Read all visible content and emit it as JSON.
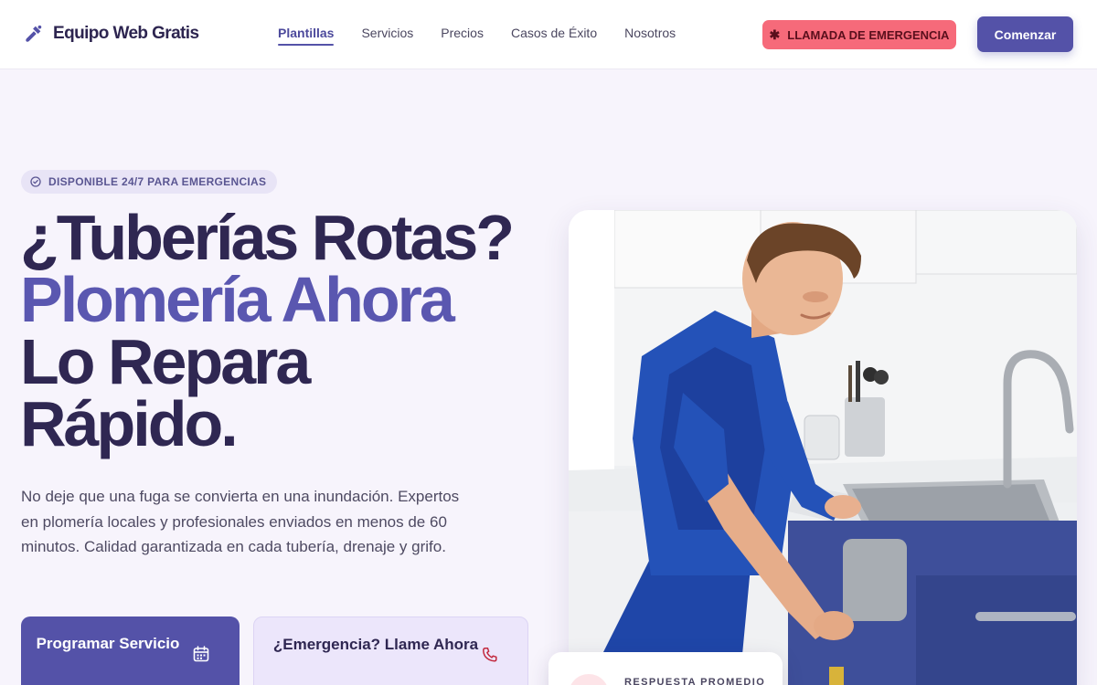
{
  "brand": {
    "name": "Equipo Web Gratis",
    "icon": "hammer-icon"
  },
  "nav": {
    "items": [
      {
        "label": "Plantillas",
        "active": true
      },
      {
        "label": "Servicios",
        "active": false
      },
      {
        "label": "Precios",
        "active": false
      },
      {
        "label": "Casos de Éxito",
        "active": false
      },
      {
        "label": "Nosotros",
        "active": false
      }
    ]
  },
  "header_actions": {
    "emergency_label": "LLAMADA DE EMERGENCIA",
    "emergency_icon": "asterisk-icon",
    "start_label": "Comenzar"
  },
  "hero": {
    "badge": "DISPONIBLE 24/7 PARA EMERGENCIAS",
    "badge_icon": "clock-check-icon",
    "headline": {
      "line1": "¿Tuberías Rotas?",
      "line2": "Plomería Ahora",
      "line3": "Lo Repara",
      "line4": "Rápido."
    },
    "description": "No deje que una fuga se convierta en una inundación. Expertos en plomería locales y profesionales enviados en menos de 60 minutos. Calidad garantizada en cada tubería, drenaje y grifo.",
    "primary_button": {
      "label": "Programar Servicio",
      "icon": "calendar-icon"
    },
    "secondary_button": {
      "label": "¿Emergencia? Llame Ahora",
      "icon": "phone-icon"
    },
    "image_alt_icon": "plumber-photo",
    "stat_card": {
      "label": "RESPUESTA PROMEDIO"
    }
  },
  "colors": {
    "primary": "#5452a8",
    "accent_text": "#5a57b0",
    "emergency": "#f66a7a",
    "heading": "#2f2752",
    "background": "#f7f4fc"
  }
}
